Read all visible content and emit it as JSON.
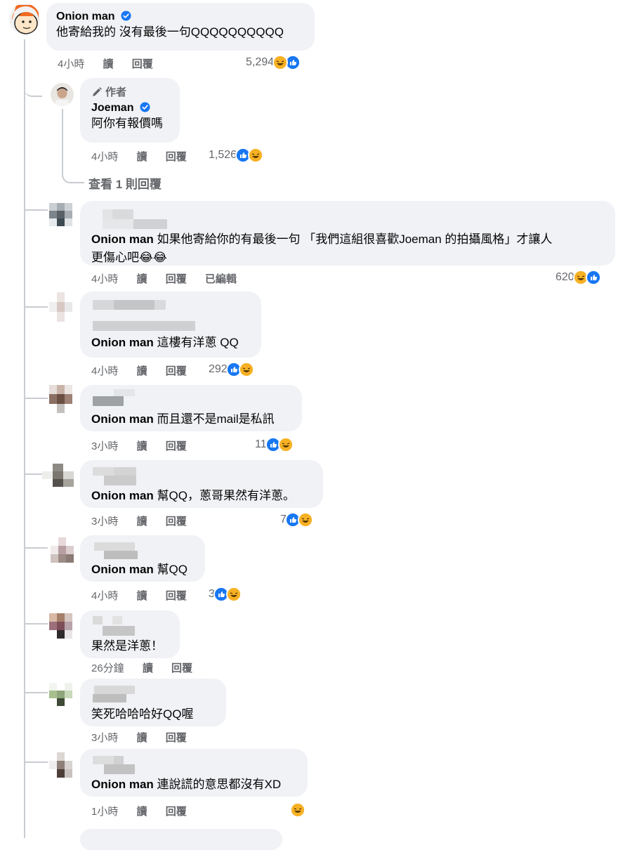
{
  "labels": {
    "read": "讀",
    "reply": "回覆",
    "edited": "已編輯",
    "author": "作者"
  },
  "colors": {
    "background": "#ffffff",
    "bubble": "#f0f2f5",
    "meta": "#65676b",
    "like_blue": "#1877f2",
    "haha_yellow": "#f7b125",
    "verified": "#1877f2",
    "thread_line": "#c9ccd1"
  },
  "top_comment": {
    "name": "Onion man",
    "verified": true,
    "text": "他寄給我的 沒有最後一句QQQQQQQQQQ",
    "time": "4小時",
    "reactions": {
      "count": "5,294",
      "icons": [
        "haha-icon",
        "like-icon"
      ]
    }
  },
  "author_reply": {
    "tag": "作者",
    "name": "Joeman",
    "verified": true,
    "text": "阿你有報價嗎",
    "time": "4小時",
    "reactions": {
      "count": "1,526",
      "icons": [
        "like-icon",
        "haha-icon"
      ]
    },
    "view_more": "查看 1 則回覆"
  },
  "replies": [
    {
      "mention": "Onion man",
      "text": " 如果他寄給你的有最後一句 「我們這組很喜歡Joeman 的拍攝風格」才讓人更傷心吧😂😂",
      "line1": " 如果他寄給你的有最後一句 「我們這組很喜歡Joeman 的拍攝風格」才讓人",
      "line2": "更傷心吧",
      "time": "4小時",
      "edited": true,
      "count": "620",
      "icons": [
        "haha-icon",
        "like-icon"
      ]
    },
    {
      "mention": "Onion man",
      "text": " 這樓有洋蔥 QQ",
      "time": "4小時",
      "count": "292",
      "icons": [
        "like-icon",
        "haha-icon"
      ]
    },
    {
      "mention": "Onion man",
      "text": " 而且還不是mail是私訊",
      "time": "3小時",
      "count": "11",
      "icons": [
        "like-icon",
        "haha-icon"
      ]
    },
    {
      "mention": "Onion man",
      "text": " 幫QQ，蔥哥果然有洋蔥。",
      "time": "3小時",
      "count": "7",
      "icons": [
        "like-icon",
        "haha-icon"
      ]
    },
    {
      "mention": "Onion man",
      "text": " 幫QQ",
      "time": "4小時",
      "count": "3",
      "icons": [
        "like-icon",
        "haha-icon"
      ]
    },
    {
      "mention": "",
      "text": "果然是洋蔥！",
      "time": "26分鐘",
      "count": "",
      "icons": []
    },
    {
      "mention": "",
      "text": "笑死哈哈哈好QQ喔",
      "time": "3小時",
      "count": "",
      "icons": []
    },
    {
      "mention": "Onion man",
      "text": " 連說謊的意思都沒有XD",
      "time": "1小時",
      "count": "",
      "icons": [
        "haha-icon"
      ]
    }
  ]
}
